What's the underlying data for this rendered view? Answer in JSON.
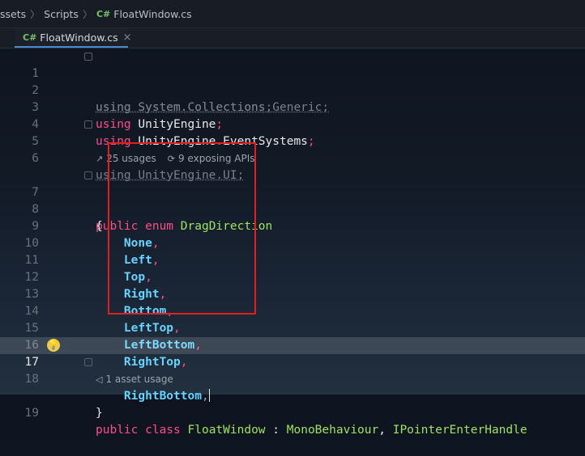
{
  "breadcrumb": {
    "items": [
      "ssets",
      "Scripts",
      "FloatWindow.cs"
    ],
    "separator": "〉",
    "cs_badge": "C#"
  },
  "tab": {
    "badge": "C#",
    "label": "FloatWindow.cs",
    "close": "×"
  },
  "hints": {
    "usages": "25 usages",
    "exposing": "9 exposing APIs",
    "asset_usage": "1 asset usage"
  },
  "lines": {
    "l1": {
      "num": "1",
      "kw": "using",
      "rest": " System.Collections;"
    },
    "l2": {
      "num": "2",
      "kw": "using",
      "rest": " System.Collections.Generic;"
    },
    "l3": {
      "num": "3",
      "kw": "using",
      "ns": " UnityEngine",
      "semi": ";"
    },
    "l4": {
      "num": "4",
      "kw": "using",
      "ns1": " UnityEngine",
      "dot": ".",
      "ns2": "EventSystems",
      "semi": ";"
    },
    "l5": {
      "num": "5",
      "kw": "using",
      "rest": " UnityEngine.UI;"
    },
    "l6": {
      "num": "6"
    },
    "l7": {
      "num": "7",
      "kw1": "public",
      "kw2": " enum",
      "type": " DragDirection"
    },
    "l8": {
      "num": "8",
      "brace": "{"
    },
    "members": [
      {
        "num": "9",
        "name": "None",
        "comma": ","
      },
      {
        "num": "10",
        "name": "Left",
        "comma": ","
      },
      {
        "num": "11",
        "name": "Top",
        "comma": ","
      },
      {
        "num": "12",
        "name": "Right",
        "comma": ","
      },
      {
        "num": "13",
        "name": "Bottom",
        "comma": ","
      },
      {
        "num": "14",
        "name": "LeftTop",
        "comma": ","
      },
      {
        "num": "15",
        "name": "LeftBottom",
        "comma": ","
      },
      {
        "num": "16",
        "name": "RightTop",
        "comma": ","
      },
      {
        "num": "17",
        "name": "RightBottom",
        "comma": ","
      }
    ],
    "l18": {
      "num": "18",
      "brace": "}"
    },
    "l19": {
      "num": "19",
      "kw1": "public",
      "kw2": " class",
      "type": " FloatWindow",
      "colon": " : ",
      "base": "MonoBehaviour",
      "comma": ", ",
      "iface": "IPointerEnterHandle"
    }
  },
  "colors": {
    "keyword": "#ff4d88",
    "type": "#9fe35f",
    "enum_member": "#67d3ff",
    "faded": "#7b808a",
    "highlight_box": "#e02020"
  },
  "icons": {
    "usages": "usages-arrow-icon",
    "exposing": "exposing-api-icon",
    "asset": "asset-usage-icon",
    "bulb": "lightbulb-icon"
  }
}
